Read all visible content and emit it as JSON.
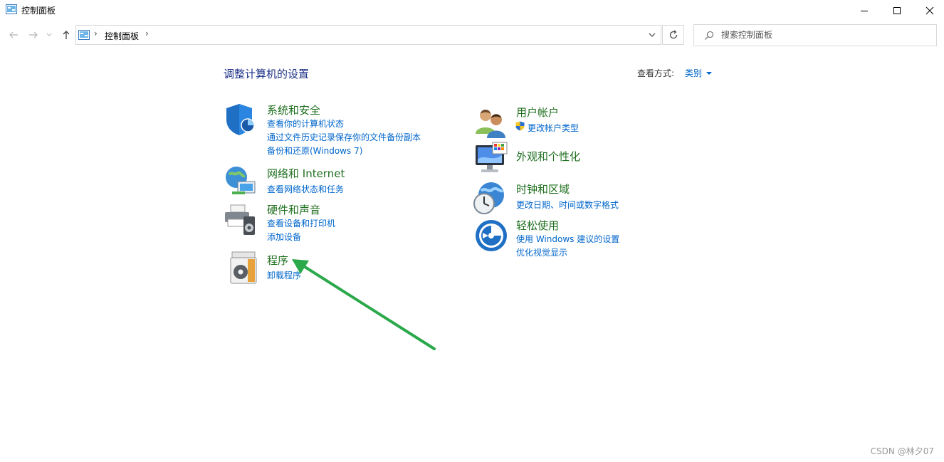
{
  "window": {
    "title": "控制面板",
    "controls": [
      "minimize",
      "maximize",
      "close"
    ]
  },
  "navigation": {
    "breadcrumb": [
      "控制面板"
    ],
    "search_placeholder": "搜索控制面板"
  },
  "main": {
    "title": "调整计算机的设置",
    "view_by_label": "查看方式:",
    "view_by_value": "类别",
    "categories": [
      {
        "title": "系统和安全",
        "icon": "shield-icon",
        "links": [
          "查看你的计算机状态",
          "通过文件历史记录保存你的文件备份副本",
          "备份和还原(Windows 7)"
        ]
      },
      {
        "title": "网络和 Internet",
        "icon": "network-globe-icon",
        "links": [
          "查看网络状态和任务"
        ]
      },
      {
        "title": "硬件和声音",
        "icon": "printer-speaker-icon",
        "links": [
          "查看设备和打印机",
          "添加设备"
        ]
      },
      {
        "title": "程序",
        "icon": "programs-disc-icon",
        "links": [
          "卸载程序"
        ]
      },
      {
        "title": "用户帐户",
        "icon": "users-icon",
        "links": [
          "更改帐户类型"
        ]
      },
      {
        "title": "外观和个性化",
        "icon": "monitor-palette-icon",
        "links": []
      },
      {
        "title": "时钟和区域",
        "icon": "globe-clock-icon",
        "links": [
          "更改日期、时间或数字格式"
        ]
      },
      {
        "title": "轻松使用",
        "icon": "ease-of-access-icon",
        "links": [
          "使用 Windows 建议的设置",
          "优化视觉显示"
        ]
      }
    ]
  },
  "annotation": {
    "arrow_color": "#2aa84a"
  },
  "watermark": "CSDN @林夕07",
  "colors": {
    "category_title": "#1e6e1e",
    "link": "#0066cc",
    "page_title": "#1e3287"
  }
}
